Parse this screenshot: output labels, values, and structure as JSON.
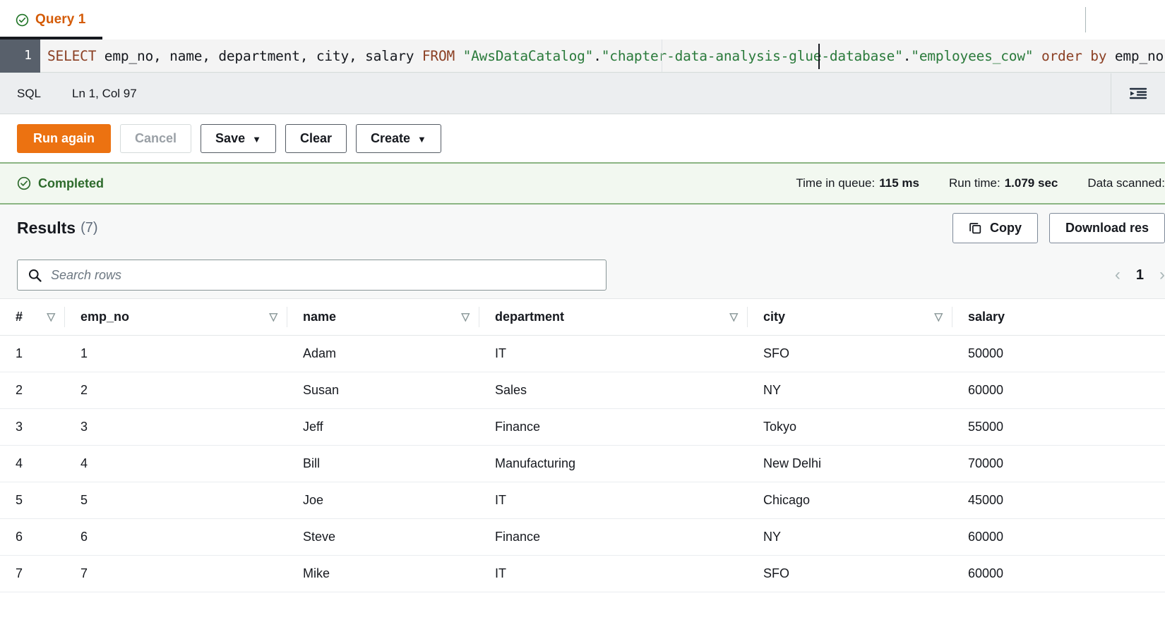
{
  "tab": {
    "label": "Query 1",
    "status_icon": "check-circle-icon"
  },
  "editor": {
    "line_number": "1",
    "sql_tokens": [
      {
        "t": "SELECT",
        "c": "kw"
      },
      {
        "t": " emp_no, name, department, city, salary ",
        "c": "plain"
      },
      {
        "t": "FROM",
        "c": "kw"
      },
      {
        "t": " ",
        "c": "plain"
      },
      {
        "t": "\"AwsDataCatalog\"",
        "c": "str"
      },
      {
        "t": ".",
        "c": "plain"
      },
      {
        "t": "\"chapter-data-analysis-glue-database\"",
        "c": "str"
      },
      {
        "t": ".",
        "c": "plain"
      },
      {
        "t": "\"employees_cow\"",
        "c": "str"
      },
      {
        "t": " ",
        "c": "plain"
      },
      {
        "t": "order by",
        "c": "kw"
      },
      {
        "t": " emp_no;",
        "c": "plain"
      }
    ],
    "full_sql": "SELECT emp_no, name, department, city, salary FROM \"AwsDataCatalog\".\"chapter-data-analysis-glue-database\".\"employees_cow\" order by emp_no;",
    "language": "SQL",
    "cursor_position": "Ln 1, Col 97",
    "format_icon": "format-indent-icon"
  },
  "actions": {
    "run_again": "Run again",
    "cancel": "Cancel",
    "save": "Save",
    "clear": "Clear",
    "create": "Create",
    "caret": "▼"
  },
  "banner": {
    "status": "Completed",
    "status_icon": "check-circle-icon",
    "metrics": [
      {
        "label": "Time in queue:",
        "value": "115 ms"
      },
      {
        "label": "Run time:",
        "value": "1.079 sec"
      },
      {
        "label": "Data scanned:",
        "value": ""
      }
    ]
  },
  "results": {
    "title": "Results",
    "count": "(7)",
    "copy_label": "Copy",
    "copy_icon": "copy-icon",
    "download_label": "Download res",
    "search_placeholder": "Search rows",
    "search_value": "",
    "search_icon": "search-icon",
    "pagination": {
      "prev": "‹",
      "page": "1",
      "next": "›"
    }
  },
  "table": {
    "filter_glyph": "▽",
    "columns": [
      "#",
      "emp_no",
      "name",
      "department",
      "city",
      "salary"
    ],
    "rows": [
      {
        "num": "1",
        "emp_no": "1",
        "name": "Adam",
        "department": "IT",
        "city": "SFO",
        "salary": "50000"
      },
      {
        "num": "2",
        "emp_no": "2",
        "name": "Susan",
        "department": "Sales",
        "city": "NY",
        "salary": "60000"
      },
      {
        "num": "3",
        "emp_no": "3",
        "name": "Jeff",
        "department": "Finance",
        "city": "Tokyo",
        "salary": "55000"
      },
      {
        "num": "4",
        "emp_no": "4",
        "name": "Bill",
        "department": "Manufacturing",
        "city": "New Delhi",
        "salary": "70000"
      },
      {
        "num": "5",
        "emp_no": "5",
        "name": "Joe",
        "department": "IT",
        "city": "Chicago",
        "salary": "45000"
      },
      {
        "num": "6",
        "emp_no": "6",
        "name": "Steve",
        "department": "Finance",
        "city": "NY",
        "salary": "60000"
      },
      {
        "num": "7",
        "emp_no": "7",
        "name": "Mike",
        "department": "IT",
        "city": "SFO",
        "salary": "60000"
      }
    ]
  },
  "colors": {
    "accent_orange": "#ec7211",
    "tab_label": "#d45b07",
    "success_green": "#2e6b2c",
    "banner_bg": "#f2f8f0",
    "gutter": "#58606b"
  }
}
